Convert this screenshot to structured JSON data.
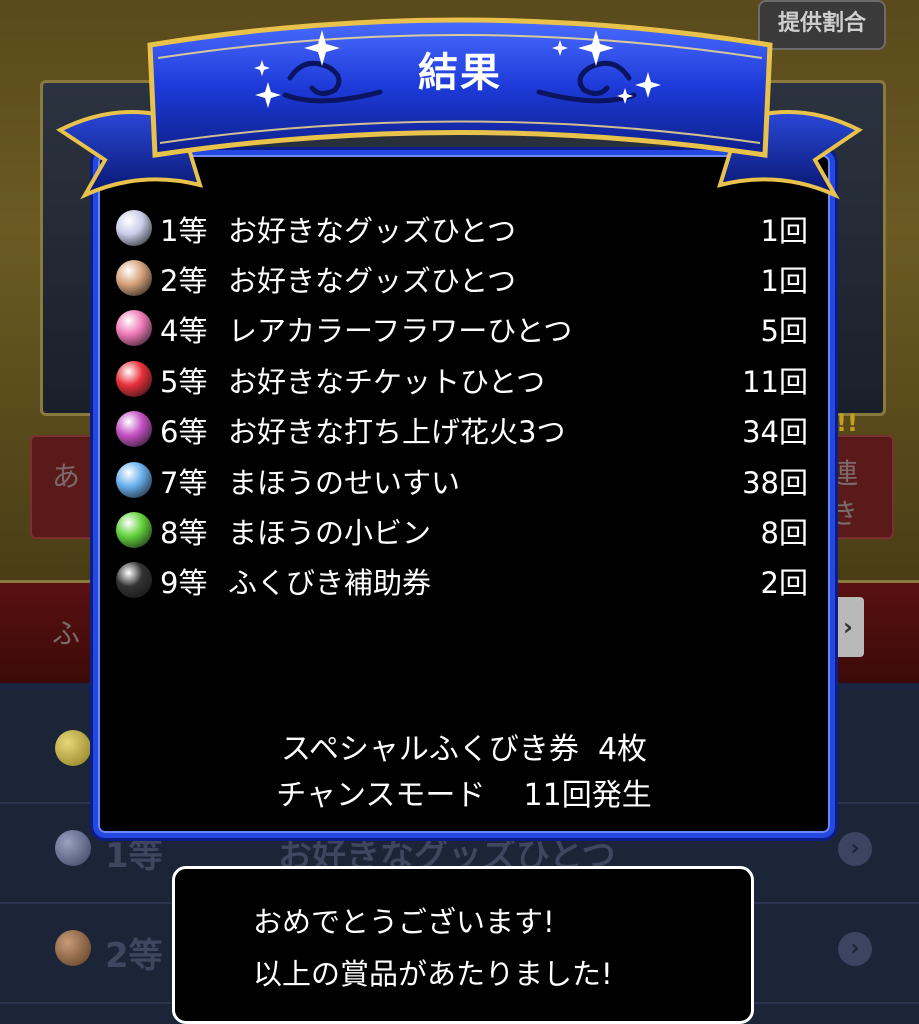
{
  "header": {
    "rates_button": "提供割合",
    "title": "結果"
  },
  "colors": {
    "panel_border": "#2448e0",
    "ribbon": "#1d3ad8",
    "gold": "#e8c24a"
  },
  "results": [
    {
      "rank": "1等",
      "name": "お好きなグッズひとつ",
      "count": "1回",
      "orb": "#c9cde8"
    },
    {
      "rank": "2等",
      "name": "お好きなグッズひとつ",
      "count": "1回",
      "orb": "#d7a27a"
    },
    {
      "rank": "4等",
      "name": "レアカラーフラワーひとつ",
      "count": "5回",
      "orb": "#f07ab8"
    },
    {
      "rank": "5等",
      "name": "お好きなチケットひとつ",
      "count": "11回",
      "orb": "#e8303a"
    },
    {
      "rank": "6等",
      "name": "お好きな打ち上げ花火3つ",
      "count": "34回",
      "orb": "#c452c4"
    },
    {
      "rank": "7等",
      "name": "まほうのせいすい",
      "count": "38回",
      "orb": "#6ab0ee"
    },
    {
      "rank": "8等",
      "name": "まほうの小ビン",
      "count": "8回",
      "orb": "#62d23c"
    },
    {
      "rank": "9等",
      "name": "ふくびき補助券",
      "count": "2回",
      "orb": "#333333"
    }
  ],
  "summary": {
    "line1": "スペシャルふくびき券  4枚",
    "line2": "チャンスモード    11回発生"
  },
  "message": {
    "line1": "おめでとうございます!",
    "line2": "以上の賞品があたりました!"
  },
  "background": {
    "badge": "中!!",
    "red_left": "あ",
    "red_right1": "連",
    "red_right2": "き",
    "bar_left": "ふ",
    "rows": [
      {
        "rank": "1等",
        "name": "お好きなグッズひとつ"
      },
      {
        "rank": "2等",
        "name": ""
      }
    ]
  }
}
